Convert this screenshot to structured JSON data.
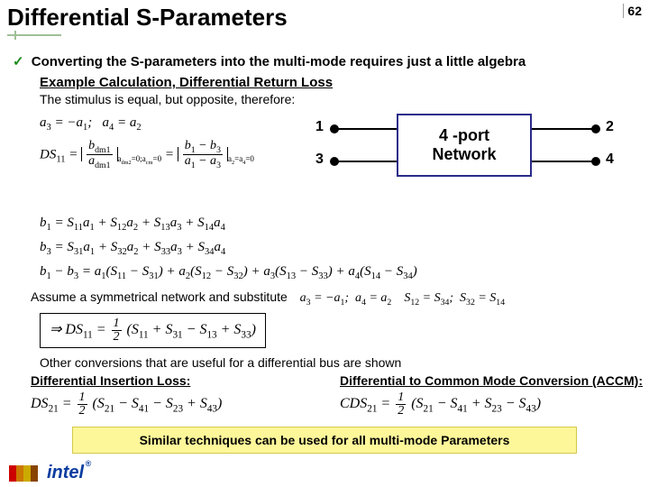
{
  "page_number": "62",
  "title": "Differential S-Parameters",
  "bullet": "Converting the S-parameters into the multi-mode requires just a little algebra",
  "example_heading": "Example Calculation, Differential Return Loss",
  "stimulus_text": "The stimulus is equal, but opposite, therefore:",
  "stimulus_eq": "a₃ = −a₁;   a₄ = a₂",
  "ds11_line1": "DS₁₁ = |bdm1 / adm1| (adm2=0; acm=0) = |(b₁ − b₃) / (a₁ − a₃)| (a₂=a₄=0)",
  "b_eqs": {
    "b1": "b₁ = S₁₁a₁ + S₁₂a₂ + S₁₃a₃ + S₁₄a₄",
    "b3": "b₃ = S₃₁a₁ + S₃₂a₂ + S₃₃a₃ + S₃₄a₄",
    "diff": "b₁ − b₃ = a₁(S₁₁ − S₃₁) + a₂(S₁₂ − S₃₂) + a₃(S₁₃ − S₃₃) + a₄(S₁₄ − S₃₄)"
  },
  "diagram": {
    "box_line1": "4 -port",
    "box_line2": "Network",
    "ports": {
      "p1": "1",
      "p2": "2",
      "p3": "3",
      "p4": "4"
    }
  },
  "assume_text": "Assume a symmetrical network and substitute",
  "assume_eq": "a₃ = −a₁;   a₄ = a₂     S₁₂ = S₃₄;   S₃₂ = S₁₄",
  "boxed_eq": "⇒ DS₁₁ = ½ (S₁₁ + S₃₁ − S₁₃ + S₃₃)",
  "other_text": "Other conversions that are useful for a differential bus are shown",
  "col_left_title": "Differential Insertion Loss:",
  "col_right_title": "Differential to Common Mode Conversion (ACCM):",
  "col_left_eq": "DS₂₁ = ½ (S₂₁ − S₄₁ − S₂₃ + S₄₃)",
  "col_right_eq": "CDS₂₁ = ½ (S₂₁ − S₄₁ + S₂₃ − S₄₃)",
  "similar_box": "Similar techniques can be used for all multi-mode Parameters",
  "intel": "intel"
}
